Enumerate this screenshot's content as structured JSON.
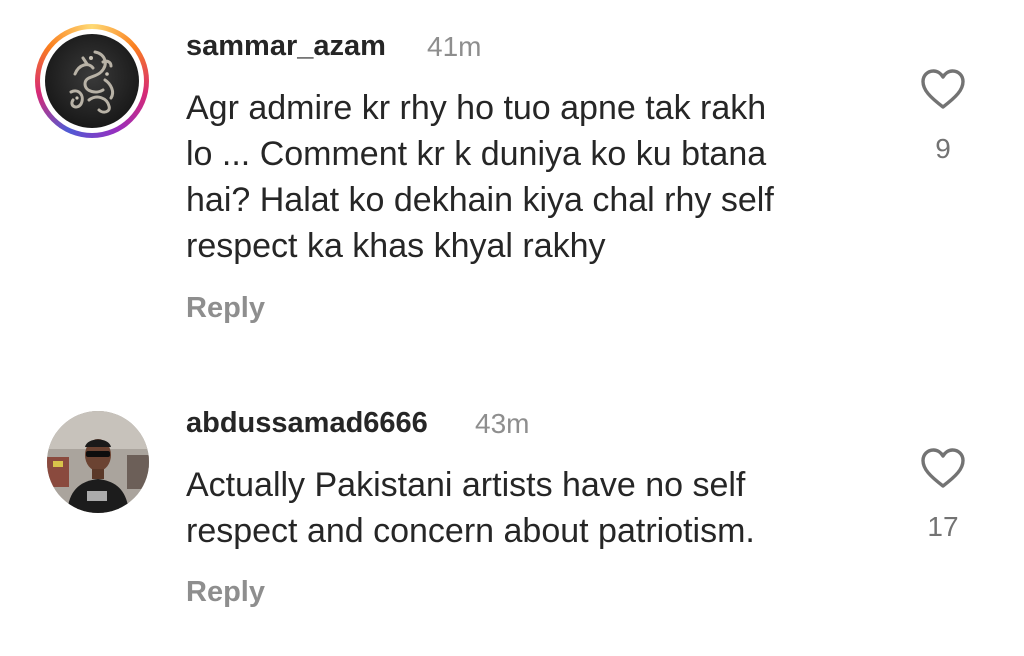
{
  "comments": [
    {
      "username": "sammar_azam",
      "time": "41m",
      "lines": [
        "Agr admire kr rhy ho tuo apne tak rakh",
        "lo ... Comment kr k duniya ko ku btana",
        "hai? Halat ko dekhain kiya chal rhy self",
        "respect ka khas khyal rakhy"
      ],
      "reply_label": "Reply",
      "likes": "9",
      "has_story_ring": true
    },
    {
      "username": "abdussamad6666",
      "time": "43m",
      "lines": [
        "Actually Pakistani artists have no self",
        "respect and concern about patriotism."
      ],
      "reply_label": "Reply",
      "likes": "17",
      "has_story_ring": false
    }
  ],
  "colors": {
    "text": "#262626",
    "muted": "#8e8e8e",
    "story_ring": [
      "#feda75",
      "#fa7e1e",
      "#d62976",
      "#962fbf",
      "#4f5bd5"
    ]
  },
  "icons": [
    "heart-icon"
  ]
}
